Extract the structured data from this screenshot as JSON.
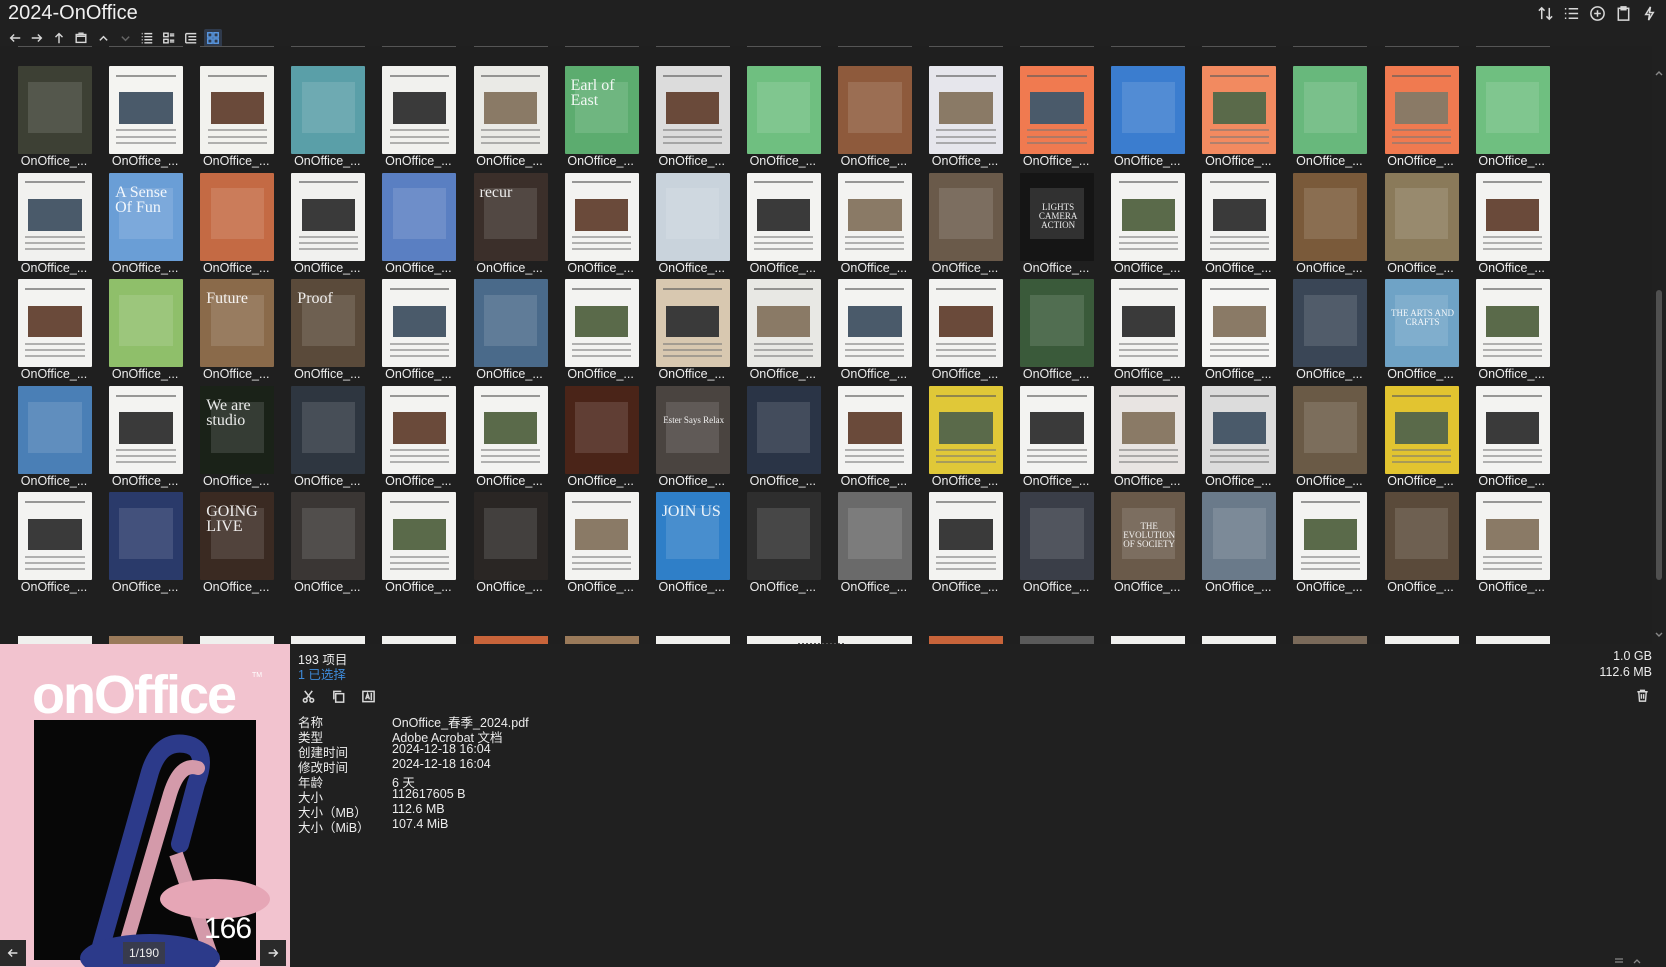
{
  "window": {
    "title": "2024-OnOffice"
  },
  "toolbar": {
    "nav": [
      "back-icon",
      "forward-icon",
      "up-icon",
      "folder-tree-icon",
      "collapse-up-icon",
      "collapse-down-icon"
    ],
    "views": [
      "list-view-icon",
      "details-view-icon",
      "tree-view-icon",
      "thumbnail-view-icon"
    ],
    "active_view": "thumbnail-view-icon",
    "right": [
      "sort-icon",
      "columns-icon",
      "add-icon",
      "clipboard-icon",
      "flash-icon"
    ]
  },
  "grid": {
    "item_label": "OnOffice_...",
    "thumbnails": [
      [
        "#3d4034",
        "#f4f4f1",
        "#f2f2ee",
        "#5a9fa8",
        "#f1f1ee",
        "#eaeae6",
        "#5cac6f",
        "#dcdcdc",
        "#6fbf80",
        "#8e5a3c",
        "#e6e6ec",
        "#f07a50",
        "#3b7dcf",
        "#f28a60",
        "#68b87c",
        "#f07a50",
        "#6fbf80"
      ],
      [
        "#f1f1ef",
        "#6a9ed6",
        "#c46a44",
        "#f1f1ef",
        "#5a7fc2",
        "#3b2f2a",
        "#f3f3f1",
        "#c9d3dc",
        "#f3f3f1",
        "#f3f3f1",
        "#6a5a4a",
        "#151515",
        "#f3f3f1",
        "#f3f3f1",
        "#7a5a3a",
        "#8a7a5a",
        "#f3f3f1"
      ],
      [
        "#f3f3f1",
        "#8fbf6a",
        "#8a6a4a",
        "#5a4a3a",
        "#f3f3f1",
        "#4a6a8a",
        "#f3f3f1",
        "#d8c8b0",
        "#e8e8e4",
        "#f3f3f1",
        "#f3f3f1",
        "#3a5a3a",
        "#f3f3f1",
        "#f6f6f4",
        "#3a4656",
        "#6fa3c6",
        "#f3f3f1"
      ],
      [
        "#4a7fb6",
        "#f3f3f1",
        "#1a2218",
        "#2e3640",
        "#f3f3f1",
        "#f3f3f1",
        "#4a2418",
        "#4a4440",
        "#2a3446",
        "#f3f3f1",
        "#e0c838",
        "#f3f3f1",
        "#e8e4e2",
        "#dcdcdc",
        "#6a5a46",
        "#e2c430",
        "#f3f3f1"
      ],
      [
        "#f3f3f1",
        "#2a3a6a",
        "#3a2a22",
        "#3a3634",
        "#f3f3f1",
        "#2a2624",
        "#f3f3f1",
        "#2f7fc8",
        "#2e2e2e",
        "#6a6a6a",
        "#f3f3f1",
        "#3a3e48",
        "#6a5a4a",
        "#6a7a8a",
        "#f3f3f1",
        "#5a4a3a",
        "#f3f3f1"
      ]
    ],
    "headlines": [
      {
        "row": 0,
        "col": 6,
        "text": "Earl of East"
      },
      {
        "row": 1,
        "col": 1,
        "text": "A Sense Of Fun"
      },
      {
        "row": 1,
        "col": 5,
        "text": "recur"
      },
      {
        "row": 1,
        "col": 11,
        "text": "LIGHTS CAMERA ACTION"
      },
      {
        "row": 2,
        "col": 2,
        "text": "Future"
      },
      {
        "row": 2,
        "col": 3,
        "text": "Proof"
      },
      {
        "row": 2,
        "col": 15,
        "text": "THE ARTS AND CRAFTS"
      },
      {
        "row": 3,
        "col": 2,
        "text": "We are studio"
      },
      {
        "row": 3,
        "col": 7,
        "text": "Ester Says Relax"
      },
      {
        "row": 4,
        "col": 2,
        "text": "GOING LIVE"
      },
      {
        "row": 4,
        "col": 7,
        "text": "JOIN US"
      },
      {
        "row": 4,
        "col": 12,
        "text": "THE EVOLUTION OF SOCIETY"
      }
    ]
  },
  "status": {
    "item_count": "193 项目",
    "selected_count": "1 已选择",
    "size_total": "1.0 GB",
    "size_selected": "112.6 MB"
  },
  "actions": [
    "cut-icon",
    "copy-icon",
    "rename-icon"
  ],
  "properties": [
    {
      "key": "名称",
      "value": "OnOffice_春季_2024.pdf"
    },
    {
      "key": "类型",
      "value": "Adobe Acrobat 文档"
    },
    {
      "key": "创建时间",
      "value": "2024-12-18  16:04"
    },
    {
      "key": "修改时间",
      "value": "2024-12-18  16:04"
    },
    {
      "key": "年龄",
      "value": "6 天"
    },
    {
      "key": "大小",
      "value": "112617605 B"
    },
    {
      "key": "大小（MB）",
      "value": "112.6 MB"
    },
    {
      "key": "大小（MiB）",
      "value": "107.4 MiB"
    }
  ],
  "preview": {
    "logo": "onOffice",
    "logo_mark": "TM",
    "issue": "166",
    "page_indicator": "1/190",
    "bg_color": "#f2c3cf"
  }
}
